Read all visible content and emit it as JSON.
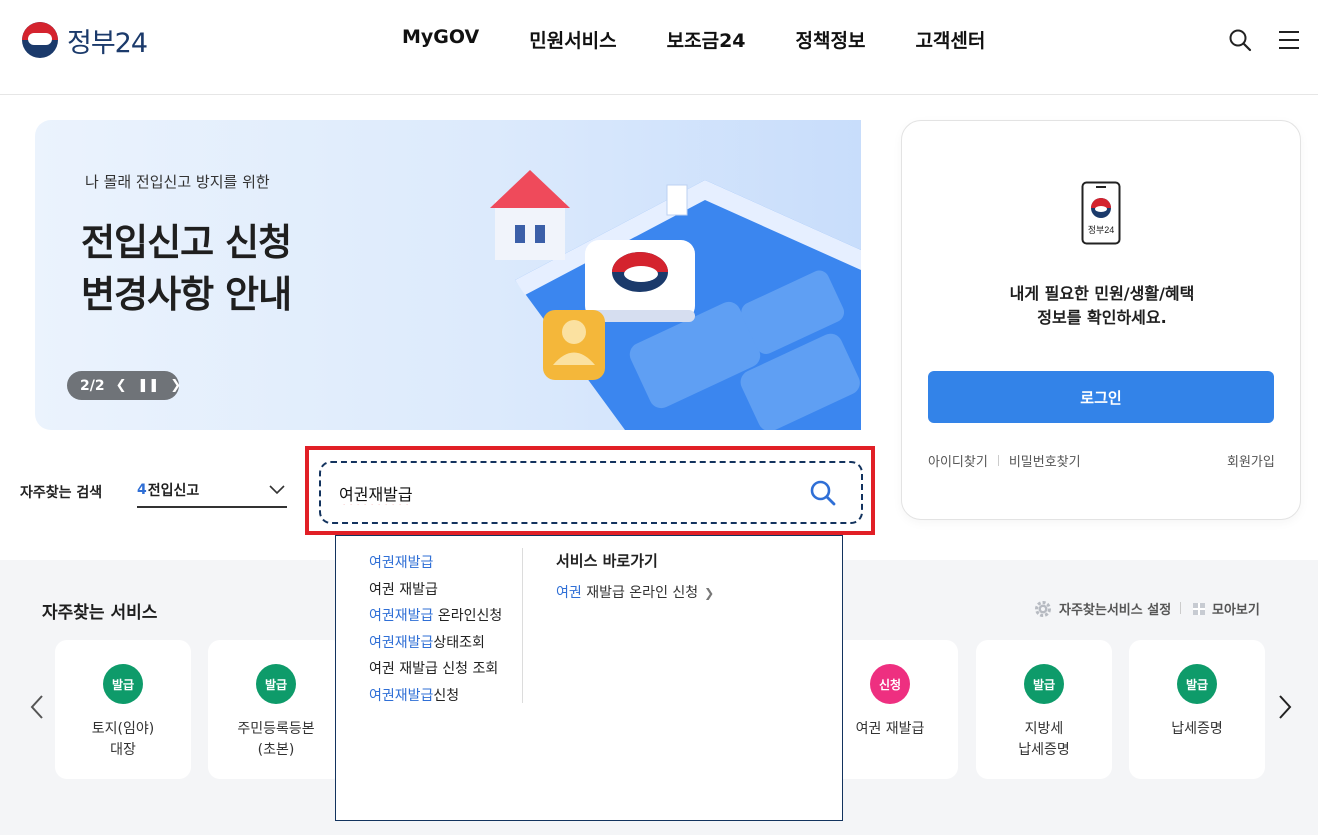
{
  "header": {
    "logo_text": "정부24",
    "nav": [
      "MyGOV",
      "민원서비스",
      "보조금24",
      "정책정보",
      "고객센터"
    ]
  },
  "banner": {
    "subtitle": "나 몰래 전입신고 방지를 위한",
    "title_line1": "전입신고 신청",
    "title_line2": "변경사항 안내",
    "pager": "2/2"
  },
  "login": {
    "phone_label": "정부24",
    "message_line1": "내게 필요한 민원/생활/혜택",
    "message_line2": "정보를 확인하세요.",
    "button": "로그인",
    "find_id": "아이디찾기",
    "find_pw": "비밀번호찾기",
    "join": "회원가입"
  },
  "search": {
    "favorite_label": "자주찾는 검색",
    "favorite_rank": "4",
    "favorite_term": "전입신고",
    "query": "여권재발급"
  },
  "dropdown": {
    "suggestions": [
      {
        "hl": "여권재발급",
        "rest": ""
      },
      {
        "hl": "",
        "rest": "여권 재발급"
      },
      {
        "hl": "여권재발급",
        "rest": " 온라인신청"
      },
      {
        "hl": "여권재발급",
        "rest": "상태조회"
      },
      {
        "hl": "",
        "rest": "여권 재발급 신청 조회"
      },
      {
        "hl": "여권재발급",
        "rest": "신청"
      }
    ],
    "shortcut_title": "서비스 바로가기",
    "shortcut_hl": "여권",
    "shortcut_rest": " 재발급 온라인 신청"
  },
  "services": {
    "title": "자주찾는 서비스",
    "setting": "자주찾는서비스 설정",
    "gather": "모아보기",
    "cards": [
      {
        "badge": "발급",
        "color": "#0e9b6a",
        "line1": "토지(임야)",
        "line2": "대장"
      },
      {
        "badge": "발급",
        "color": "#0e9b6a",
        "line1": "주민등록등본",
        "line2": "(초본)"
      },
      {
        "badge": "신청",
        "color": "#ee2f80",
        "line1": "여권 재발급",
        "line2": ""
      },
      {
        "badge": "발급",
        "color": "#0e9b6a",
        "line1": "지방세",
        "line2": "납세증명"
      },
      {
        "badge": "발급",
        "color": "#0e9b6a",
        "line1": "납세증명",
        "line2": ""
      }
    ]
  }
}
